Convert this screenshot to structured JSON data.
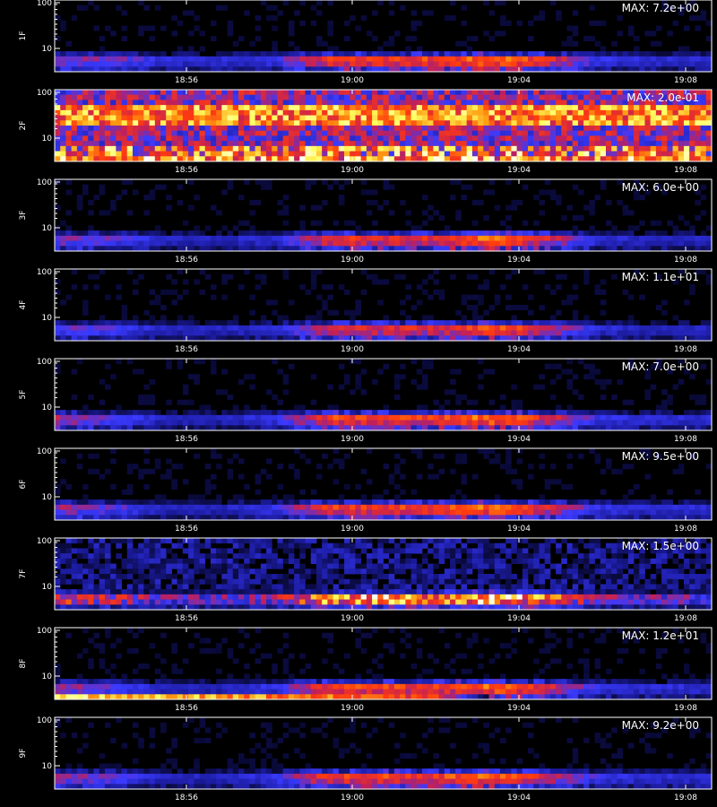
{
  "chart_data": {
    "type": "heatmap",
    "title": "",
    "xlabel": "",
    "x_ticks": [
      "18:56",
      "19:00",
      "19:04",
      "19:08"
    ],
    "y_ticks": [
      "100",
      "10"
    ],
    "yscale": "log",
    "grid": false,
    "colormap": [
      "#000000",
      "#1a1a9a",
      "#3a3aff",
      "#c0205a",
      "#ff3a10",
      "#ff9a10",
      "#ffff60",
      "#ffffff"
    ],
    "panels": [
      {
        "label": "1F",
        "max_label": "MAX: 7.2e+00",
        "profile": [
          0.55,
          0.55,
          0.35,
          0.35,
          0.4,
          0.85,
          0.85,
          0.85,
          1.0,
          0.8,
          0.4,
          0.35,
          0.35
        ],
        "noise": 0.1
      },
      {
        "label": "2F",
        "max_label": "MAX: 2.0e-01",
        "profile": [
          0.7,
          0.7,
          0.7,
          0.7,
          0.7,
          0.7,
          0.7,
          0.7,
          0.7,
          0.7,
          0.7,
          0.7,
          0.7
        ],
        "noise": 0.9
      },
      {
        "label": "3F",
        "max_label": "MAX: 6.0e+00",
        "profile": [
          0.55,
          0.5,
          0.3,
          0.3,
          0.35,
          0.8,
          0.8,
          0.8,
          1.0,
          0.75,
          0.35,
          0.3,
          0.3
        ],
        "noise": 0.1
      },
      {
        "label": "4F",
        "max_label": "MAX: 1.1e+01",
        "profile": [
          0.5,
          0.45,
          0.3,
          0.3,
          0.35,
          0.75,
          0.75,
          0.75,
          0.95,
          0.7,
          0.35,
          0.3,
          0.3
        ],
        "noise": 0.1
      },
      {
        "label": "5F",
        "max_label": "MAX: 7.0e+00",
        "profile": [
          0.65,
          0.5,
          0.3,
          0.3,
          0.4,
          0.85,
          0.85,
          0.85,
          1.0,
          0.75,
          0.4,
          0.35,
          0.35
        ],
        "noise": 0.1
      },
      {
        "label": "6F",
        "max_label": "MAX: 9.5e+00",
        "profile": [
          0.6,
          0.5,
          0.3,
          0.3,
          0.4,
          0.85,
          0.85,
          0.85,
          1.0,
          0.75,
          0.4,
          0.35,
          0.35
        ],
        "noise": 0.1
      },
      {
        "label": "7F",
        "max_label": "MAX: 1.5e+00",
        "profile": [
          0.6,
          0.5,
          0.35,
          0.35,
          0.4,
          0.8,
          0.8,
          0.75,
          0.95,
          0.7,
          0.4,
          0.35,
          0.35
        ],
        "noise": 0.35
      },
      {
        "label": "8F",
        "max_label": "MAX: 1.2e+01",
        "profile": [
          0.6,
          0.5,
          0.3,
          0.3,
          0.4,
          0.85,
          0.85,
          0.85,
          1.0,
          0.75,
          0.4,
          0.35,
          0.35
        ],
        "noise": 0.1,
        "bottom_band": [
          0.95,
          0.95,
          0.9,
          0.85,
          0.8,
          0.75,
          0.7,
          0.6,
          0.0,
          0.0,
          0.0,
          0.0,
          0.0
        ]
      },
      {
        "label": "9F",
        "max_label": "MAX: 9.2e+00",
        "profile": [
          0.6,
          0.5,
          0.3,
          0.3,
          0.4,
          0.85,
          0.85,
          0.85,
          1.0,
          0.75,
          0.4,
          0.35,
          0.35
        ],
        "noise": 0.1
      }
    ]
  }
}
